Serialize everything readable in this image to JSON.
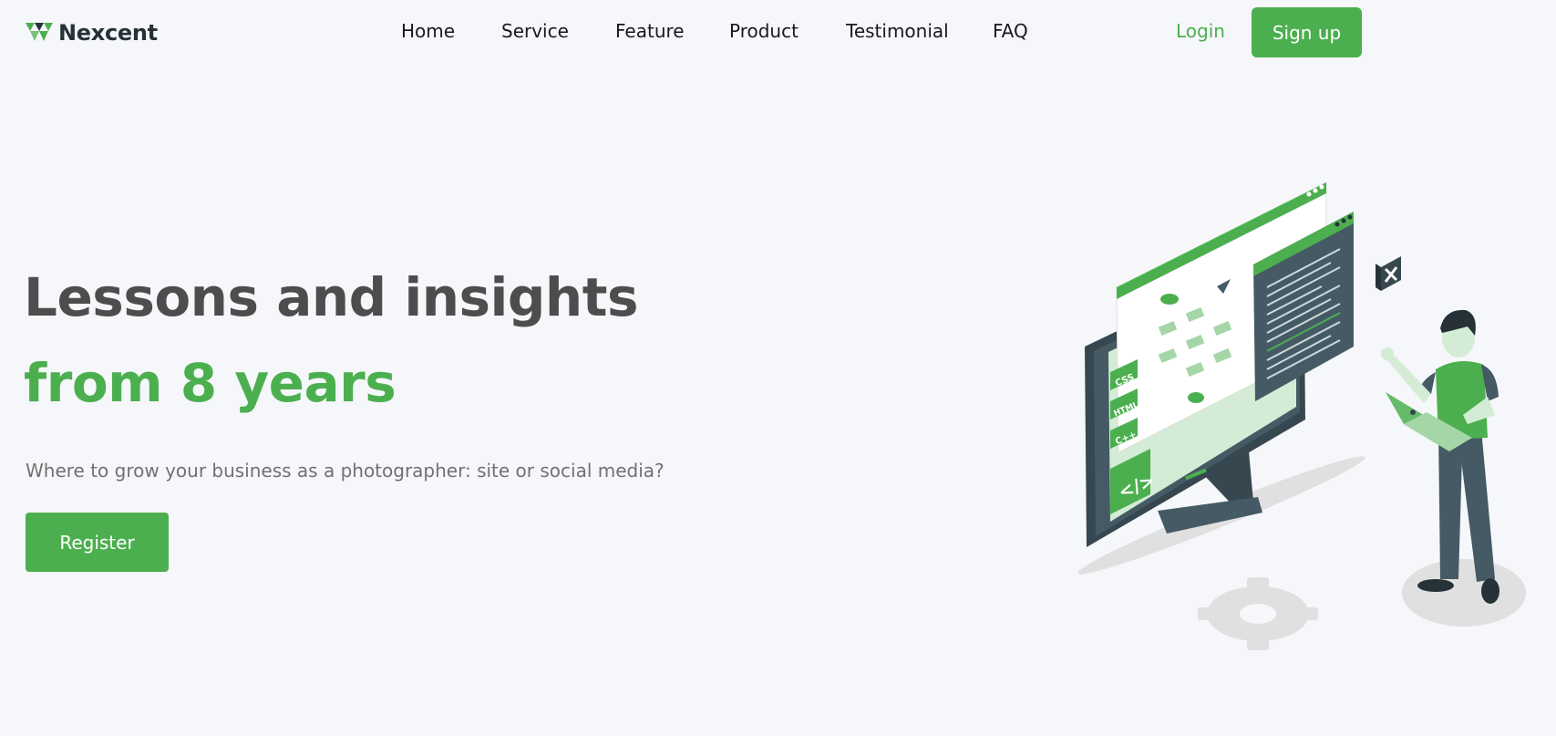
{
  "brand": {
    "name": "Nexcent",
    "logo_icon": "nexcent-logo-icon"
  },
  "nav": {
    "items": [
      {
        "label": "Home"
      },
      {
        "label": "Service"
      },
      {
        "label": "Feature"
      },
      {
        "label": "Product"
      },
      {
        "label": "Testimonial"
      },
      {
        "label": "FAQ"
      }
    ]
  },
  "auth": {
    "login_label": "Login",
    "signup_label": "Sign up"
  },
  "hero": {
    "title_line1": "Lessons and insights",
    "title_line2": "from 8 years",
    "subtitle": "Where to grow your business as a photographer: site or social media?",
    "cta_label": "Register"
  },
  "illustration": {
    "badges": [
      "CSS",
      "HTML",
      "C++"
    ],
    "code_icon": "</>"
  },
  "colors": {
    "accent": "#4caf4f",
    "heading": "#4d4d4d",
    "body_text": "#717171",
    "background": "#f5f7fa",
    "dark": "#263238"
  }
}
